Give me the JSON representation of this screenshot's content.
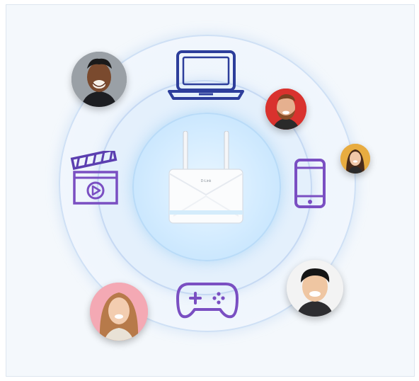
{
  "illustration": {
    "center_device": {
      "name": "router",
      "brand_text": "D-Link"
    },
    "ring_icons": [
      {
        "name": "laptop-icon"
      },
      {
        "name": "smartphone-icon"
      },
      {
        "name": "gamepad-icon"
      },
      {
        "name": "video-clapperboard-icon"
      }
    ],
    "avatars": [
      {
        "name": "avatar-man-laughing",
        "background": "#8a8f96"
      },
      {
        "name": "avatar-man-beard",
        "background": "#d9322e"
      },
      {
        "name": "avatar-woman-small",
        "background": "#e4a93c"
      },
      {
        "name": "avatar-man-smiling",
        "background": "#f2f2f2"
      },
      {
        "name": "avatar-woman-pink",
        "background": "#f3a7b2"
      }
    ],
    "colors": {
      "line_icon_blue": "#2d3e9b",
      "line_icon_purple": "#7a4fc2",
      "ring_glow": "#bfe0fb",
      "panel_background": "#f4f8fc"
    }
  }
}
